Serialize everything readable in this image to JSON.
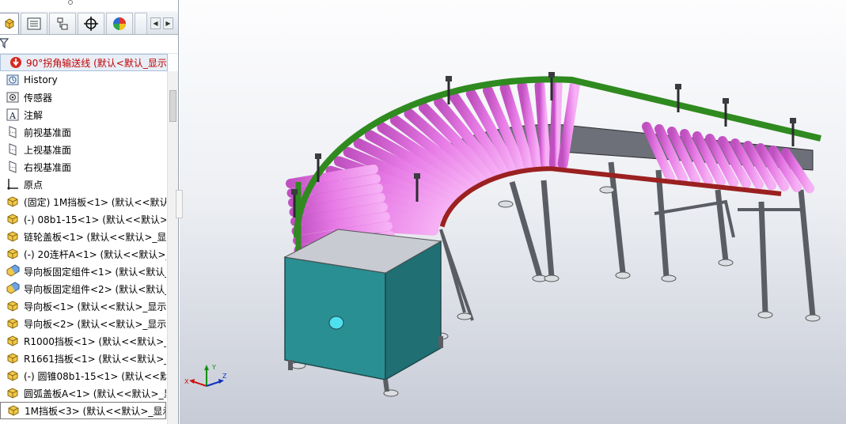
{
  "feature_tree": {
    "root": {
      "label": "90°拐角输送线 (默认<默认_显示",
      "icon": "assembly-error-icon"
    },
    "items": [
      {
        "label": "History",
        "icon": "history-icon"
      },
      {
        "label": "传感器",
        "icon": "sensor-icon"
      },
      {
        "label": "注解",
        "icon": "annotation-icon"
      },
      {
        "label": "前视基准面",
        "icon": "plane-icon"
      },
      {
        "label": "上视基准面",
        "icon": "plane-icon"
      },
      {
        "label": "右视基准面",
        "icon": "plane-icon"
      },
      {
        "label": "原点",
        "icon": "origin-icon"
      },
      {
        "label": "(固定) 1M挡板<1> (默认<<默认",
        "icon": "part-icon"
      },
      {
        "label": "(-) 08b1-15<1> (默认<<默认>_",
        "icon": "part-icon"
      },
      {
        "label": "链轮盖板<1> (默认<<默认>_显示",
        "icon": "part-icon"
      },
      {
        "label": "(-) 20连杆A<1> (默认<<默认>_",
        "icon": "part-icon"
      },
      {
        "label": "导向板固定组件<1> (默认<默认_",
        "icon": "subassembly-icon"
      },
      {
        "label": "导向板固定组件<2> (默认<默认_",
        "icon": "subassembly-icon"
      },
      {
        "label": "导向板<1> (默认<<默认>_显示状",
        "icon": "part-icon"
      },
      {
        "label": "导向板<2> (默认<<默认>_显示状",
        "icon": "part-icon"
      },
      {
        "label": "R1000挡板<1> (默认<<默认>_显",
        "icon": "part-icon"
      },
      {
        "label": "R1661挡板<1> (默认<<默认>_显",
        "icon": "part-icon"
      },
      {
        "label": "(-) 圆锥08b1-15<1> (默认<<默认",
        "icon": "part-icon"
      },
      {
        "label": "圆弧盖板A<1> (默认<<默认>_显",
        "icon": "part-icon"
      },
      {
        "label": "1M挡板<3> (默认<<默认>_显示",
        "icon": "part-icon"
      }
    ],
    "selected_index": 19
  },
  "tabs": [
    {
      "name": "featuremanager",
      "icon": "assembly-tab-icon"
    },
    {
      "name": "propertymanager",
      "icon": "property-tab-icon"
    },
    {
      "name": "configurationmanager",
      "icon": "config-tab-icon"
    },
    {
      "name": "dimxpertmanager",
      "icon": "crosshair-tab-icon"
    },
    {
      "name": "displaymanager",
      "icon": "display-tab-icon"
    }
  ],
  "triad": {
    "x": "X",
    "y": "Y",
    "z": "Z"
  },
  "colors": {
    "roller": "#e77be6",
    "guard_green": "#2f8a1f",
    "rail_red": "#9b2020",
    "frame_grey": "#5a5d63",
    "cabinet_teal": "#2a8f92",
    "root_label": "#c00000"
  }
}
